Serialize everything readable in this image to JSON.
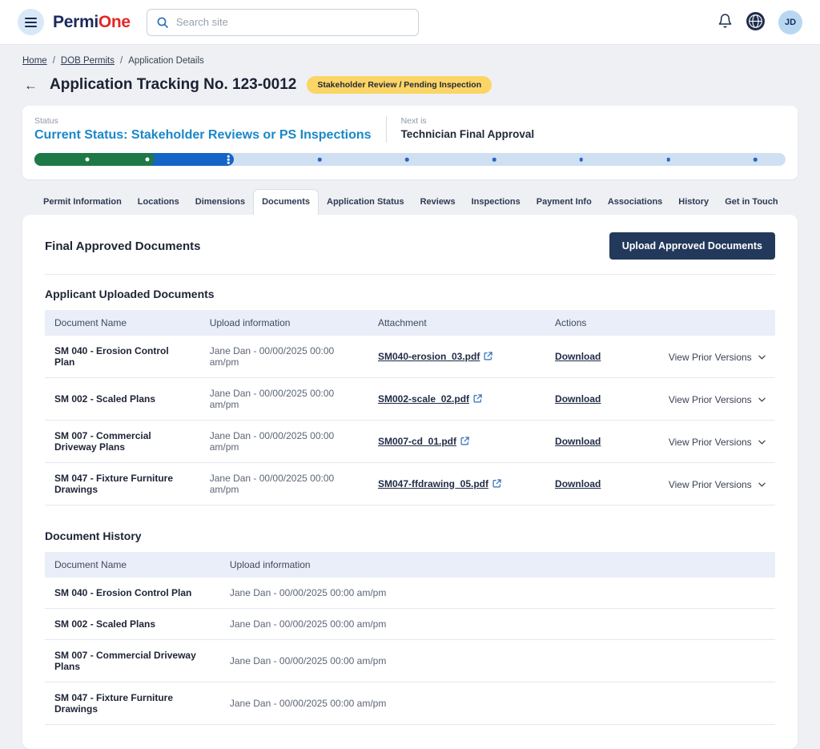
{
  "colors": {
    "logo_navy": "#1b2a5e",
    "logo_red": "#e32726",
    "status_blue": "#1a87c8",
    "progress_green": "#1d7a46",
    "progress_blue": "#1565c8",
    "progress_track": "#cfe0f3",
    "badge_bg": "#fbd565",
    "button_bg": "#23395b",
    "table_header_bg": "#e9eef8"
  },
  "icons": {
    "menu": "hamburger",
    "search": "magnifier",
    "notifications": "bell",
    "language": "globe",
    "external_link": "box-with-arrow",
    "chevron_down": "⌄",
    "back": "←"
  },
  "header": {
    "brand_part1": "Permi",
    "brand_part2": "One",
    "search_placeholder": "Search site",
    "avatar_initials": "JD"
  },
  "breadcrumb": {
    "items": [
      "Home",
      "DOB Permits",
      "Application Details"
    ],
    "separator": "/"
  },
  "page_header": {
    "back_arrow": "←",
    "title": "Application Tracking No. 123-0012",
    "status_badge": "Stakeholder Review / Pending Inspection"
  },
  "status_card": {
    "status_label": "Status",
    "current_status": "Current Status: Stakeholder Reviews or PS Inspections",
    "next_label": "Next is",
    "next_value": "Technician Final Approval",
    "progress": {
      "completed_pct": 16,
      "current_pct": 26.5
    }
  },
  "tabs": {
    "items": [
      "Permit Information",
      "Locations",
      "Dimensions",
      "Documents",
      "Application Status",
      "Reviews",
      "Inspections",
      "Payment Info",
      "Associations",
      "History",
      "Get in Touch"
    ],
    "active": "Documents"
  },
  "content": {
    "section_title": "Final Approved Documents",
    "upload_button_label": "Upload Approved Documents",
    "uploaded_documents": {
      "title": "Applicant Uploaded Documents",
      "headers": [
        "Document Name",
        "Upload information",
        "Attachment",
        "Actions"
      ],
      "download_label": "Download",
      "view_prior_label": "View Prior Versions",
      "rows": [
        {
          "name": "SM 040 - Erosion Control Plan",
          "upload_info": "Jane Dan - 00/00/2025 00:00 am/pm",
          "attachment": "SM040-erosion_03.pdf"
        },
        {
          "name": "SM 002 - Scaled Plans",
          "upload_info": "Jane Dan - 00/00/2025 00:00 am/pm",
          "attachment": "SM002-scale_02.pdf"
        },
        {
          "name": "SM 007 - Commercial Driveway Plans",
          "upload_info": "Jane Dan - 00/00/2025 00:00 am/pm",
          "attachment": "SM007-cd_01.pdf"
        },
        {
          "name": "SM 047 - Fixture Furniture Drawings",
          "upload_info": "Jane Dan - 00/00/2025 00:00 am/pm",
          "attachment": "SM047-ffdrawing_05.pdf"
        }
      ]
    },
    "document_history": {
      "title": "Document History",
      "headers": [
        "Document Name",
        "Upload information"
      ],
      "rows": [
        {
          "name": "SM 040 - Erosion Control Plan",
          "upload_info": "Jane Dan - 00/00/2025 00:00 am/pm"
        },
        {
          "name": "SM 002 - Scaled Plans",
          "upload_info": "Jane Dan - 00/00/2025 00:00 am/pm"
        },
        {
          "name": "SM 007 - Commercial Driveway Plans",
          "upload_info": "Jane Dan - 00/00/2025 00:00 am/pm"
        },
        {
          "name": "SM 047 - Fixture Furniture Drawings",
          "upload_info": "Jane Dan - 00/00/2025 00:00 am/pm"
        }
      ]
    }
  }
}
